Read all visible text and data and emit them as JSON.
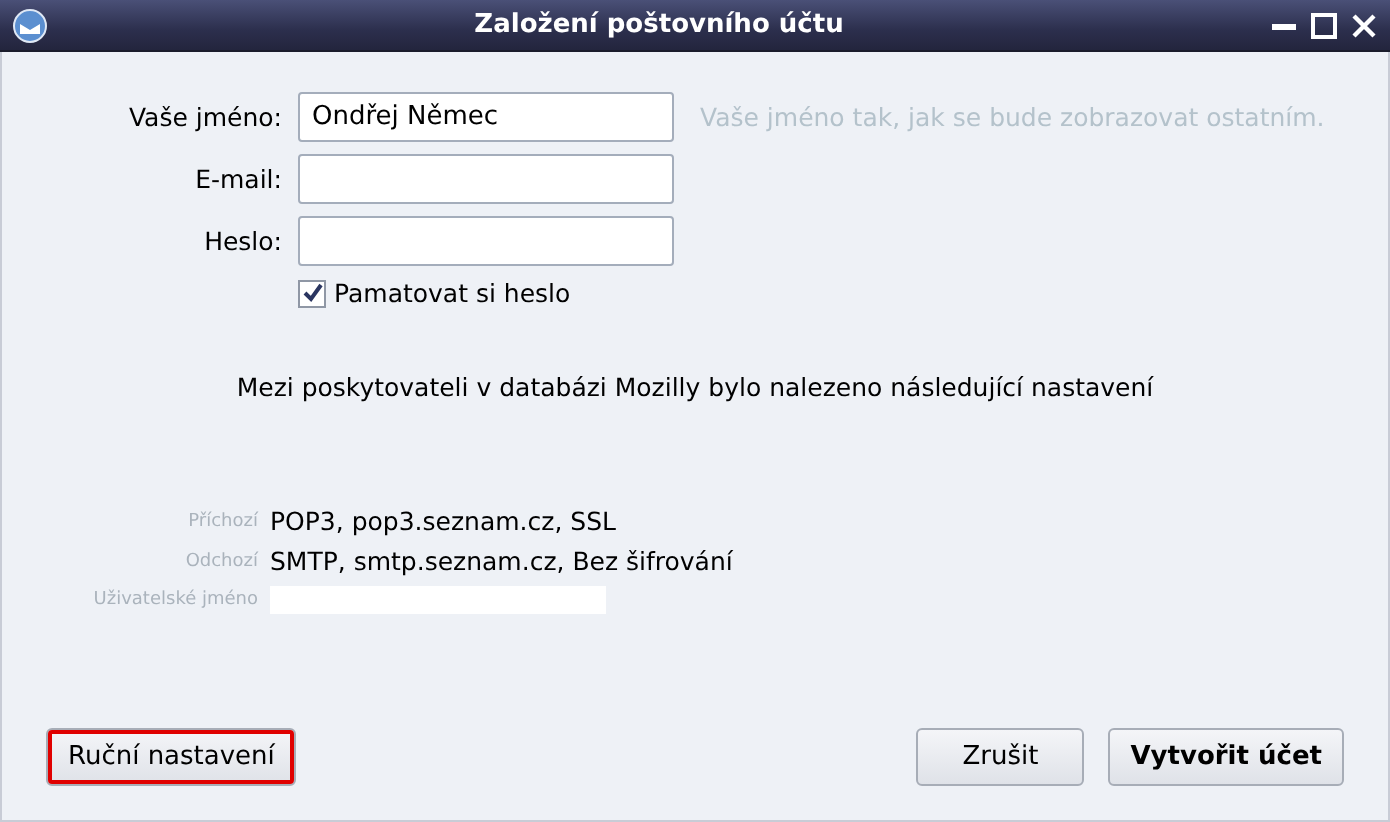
{
  "window": {
    "title": "Založení poštovního účtu"
  },
  "fields": [
    {
      "label": "Vaše jméno:",
      "value": "Ondřej Němec",
      "hint": "Vaše jméno tak, jak se bude zobrazovat ostatním."
    },
    {
      "label": "E-mail:"
    },
    {
      "label": "Heslo:"
    }
  ],
  "remember_password": {
    "label": "Pamatovat si heslo",
    "checked": true
  },
  "message": "Mezi poskytovateli v databázi Mozilly bylo nalezeno následující nastavení",
  "settings": [
    {
      "label": "Příchozí",
      "value": "POP3, pop3.seznam.cz, SSL"
    },
    {
      "label": "Odchozí",
      "value": "SMTP, smtp.seznam.cz, Bez šifrování"
    }
  ],
  "username": {
    "label": "Uživatelské jméno"
  },
  "buttons": [
    {
      "label": "Ruční nastavení",
      "kind": "manual",
      "highlighted": true
    },
    {
      "label": "Zrušit",
      "kind": "cancel",
      "highlighted": false
    },
    {
      "label": "Vytvořit účet",
      "kind": "create",
      "highlighted": false
    }
  ]
}
